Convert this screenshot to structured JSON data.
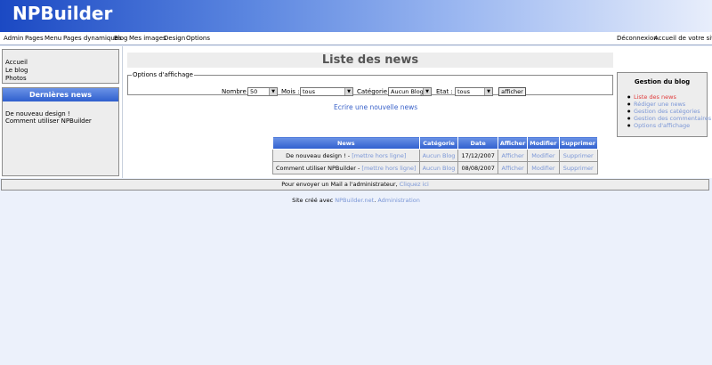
{
  "site": {
    "logo": "NPBuilder"
  },
  "topnav": {
    "left": [
      "Admin",
      "Pages",
      "Menu",
      "Pages dynamiques",
      "Blog",
      "Mes images",
      "Design",
      "Options"
    ],
    "right": [
      "Déconnexion",
      "Accueil de votre site"
    ]
  },
  "left_menu": {
    "items": [
      "Accueil",
      "Le blog",
      "Photos"
    ]
  },
  "latest_news": {
    "title": "Dernières news",
    "items": [
      "De nouveau design !",
      "Comment utiliser NPBuilder"
    ]
  },
  "main": {
    "title": "Liste des news",
    "options": {
      "legend": "Options d'affichage",
      "nombre_label": "Nombre :",
      "nombre_value": "50",
      "mois_label": "Mois :",
      "mois_value": "tous",
      "categorie_label": "Catégorie :",
      "categorie_value": "Aucun Blog",
      "etat_label": "Etat :",
      "etat_value": "tous",
      "submit": "afficher"
    },
    "write_link": "Ecrire une nouvelle news",
    "table": {
      "headers": [
        "News",
        "Catégorie",
        "Date",
        "Afficher",
        "Modifier",
        "Supprimer"
      ],
      "rows": [
        {
          "title": "De nouveau design !",
          "sep": "-",
          "offline": "[mettre hors ligne]",
          "category": "Aucun Blog",
          "date": "17/12/2007",
          "show": "Afficher",
          "edit": "Modifier",
          "delete": "Supprimer"
        },
        {
          "title": "Comment utiliser NPBuilder",
          "sep": "-",
          "offline": "[mettre hors ligne]",
          "category": "Aucun Blog",
          "date": "08/08/2007",
          "show": "Afficher",
          "edit": "Modifier",
          "delete": "Supprimer"
        }
      ]
    }
  },
  "blog_panel": {
    "title": "Gestion du blog",
    "items": [
      "Liste des news",
      "Rédiger une news",
      "Gestion des catégories",
      "Gestion des commentaires",
      "Options d'affichage"
    ]
  },
  "footer": {
    "mail_text": "Pour envoyer un Mail a l'administrateur,",
    "mail_link": "Cliquez ici",
    "credit_text": "Site créé avec",
    "credit_link": "NPBuilder.net",
    "credit_sep": ".",
    "admin_link": "Administration"
  },
  "colors": {
    "header_blue": "#1b49c3",
    "link_blue": "#7a96d6",
    "active_red": "#e03b3b"
  }
}
